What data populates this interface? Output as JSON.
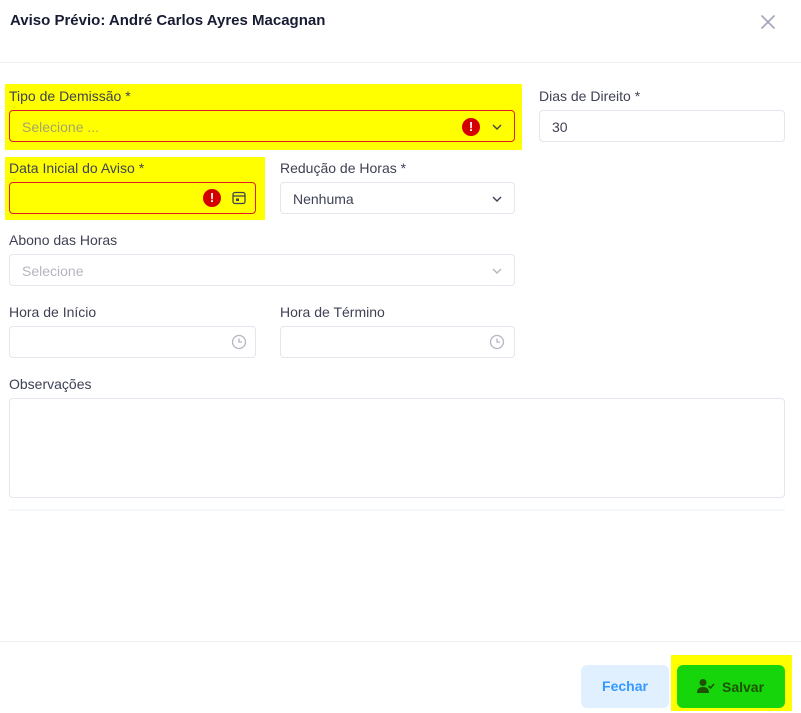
{
  "modal": {
    "title": "Aviso Prévio: André Carlos Ayres Macagnan"
  },
  "form": {
    "tipo_demissao": {
      "label": "Tipo de Demissão *",
      "placeholder": "Selecione ..."
    },
    "dias_direito": {
      "label": "Dias de Direito *",
      "value": "30"
    },
    "data_inicial": {
      "label": "Data Inicial do Aviso *",
      "value": ""
    },
    "reducao_horas": {
      "label": "Redução de Horas *",
      "value": "Nenhuma"
    },
    "abono_horas": {
      "label": "Abono das Horas",
      "placeholder": "Selecione"
    },
    "hora_inicio": {
      "label": "Hora de Início",
      "value": ""
    },
    "hora_termino": {
      "label": "Hora de Término",
      "value": ""
    },
    "observacoes": {
      "label": "Observações",
      "value": ""
    }
  },
  "footer": {
    "close_label": "Fechar",
    "save_label": "Salvar"
  },
  "colors": {
    "highlight": "#ffff00",
    "error": "#d40000",
    "save_button": "#16d50a",
    "close_button_bg": "#e1f0ff",
    "close_button_text": "#3699ff"
  },
  "icons": [
    "close-icon",
    "error-icon",
    "chevron-down-icon",
    "calendar-icon",
    "clock-icon",
    "user-check-icon"
  ]
}
